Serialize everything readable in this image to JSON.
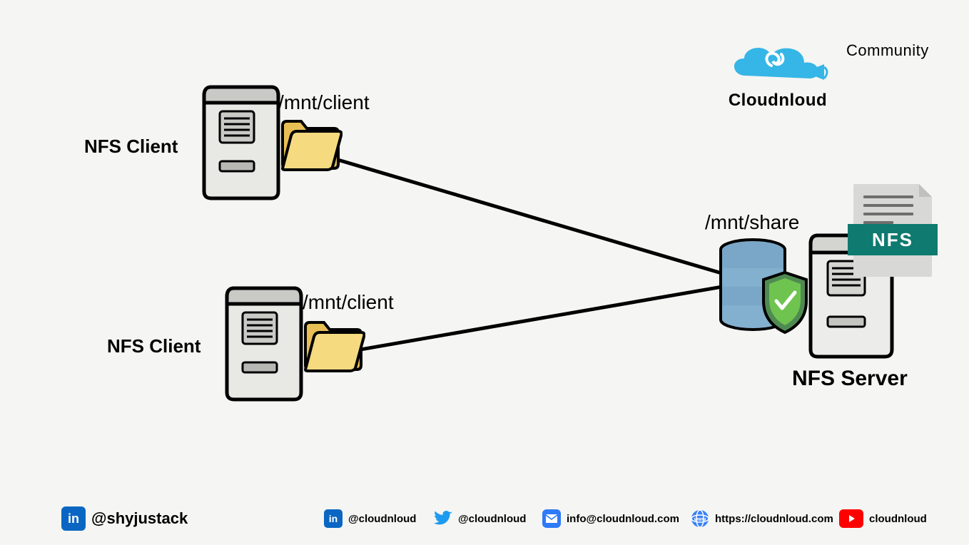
{
  "brand": {
    "name": "Cloudnloud",
    "tag": "Community"
  },
  "server": {
    "label": "NFS Server",
    "path": "/mnt/share",
    "doc_badge": "NFS"
  },
  "clients": [
    {
      "label": "NFS Client",
      "path": "/mnt/client"
    },
    {
      "label": "NFS Client",
      "path": "/mnt/client"
    }
  ],
  "footer": {
    "author_handle": "@shyjustack",
    "links": [
      {
        "icon": "linkedin",
        "text": "@cloudnloud"
      },
      {
        "icon": "twitter",
        "text": "@cloudnloud"
      },
      {
        "icon": "mail",
        "text": "info@cloudnloud.com"
      },
      {
        "icon": "www",
        "text": "https://cloudnloud.com"
      },
      {
        "icon": "youtube",
        "text": "cloudnloud"
      }
    ]
  }
}
